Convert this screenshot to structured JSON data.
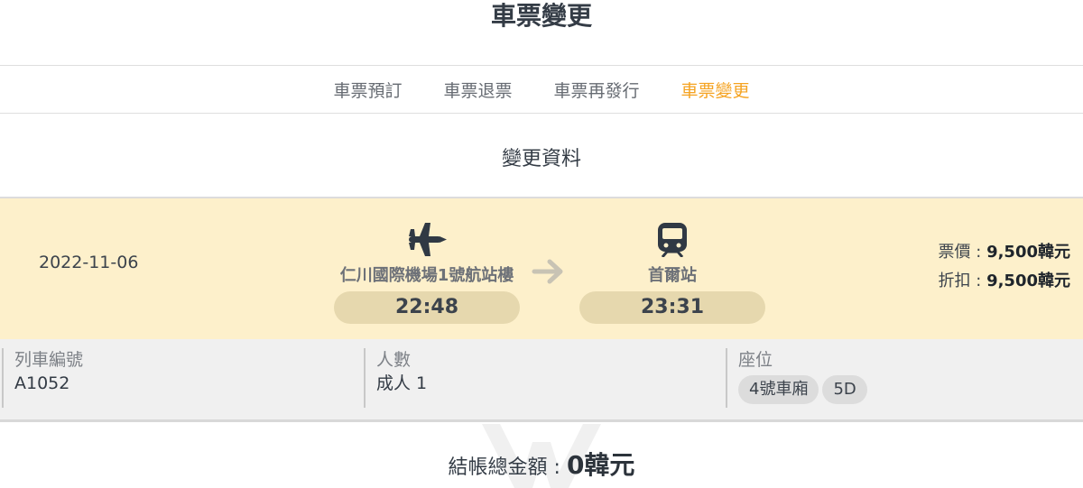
{
  "header": {
    "title": "車票變更"
  },
  "tabs": [
    {
      "label": "車票預訂",
      "active": false
    },
    {
      "label": "車票退票",
      "active": false
    },
    {
      "label": "車票再發行",
      "active": false
    },
    {
      "label": "車票變更",
      "active": true
    }
  ],
  "section": {
    "title": "變更資料"
  },
  "journey": {
    "date": "2022-11-06",
    "departure": {
      "icon": "airplane-icon",
      "station": "仁川國際機場1號航站樓",
      "time": "22:48"
    },
    "arrival": {
      "icon": "train-icon",
      "station": "首爾站",
      "time": "23:31"
    },
    "fare_label": "票價 : ",
    "fare_value": "9,500韓元",
    "discount_label": "折扣 : ",
    "discount_value": "9,500韓元"
  },
  "details": {
    "train_no_label": "列車編號",
    "train_no": "A1052",
    "passengers_label": "人數",
    "passengers": "成人 1",
    "seat_label": "座位",
    "car": "4號車廂",
    "seat": "5D"
  },
  "total": {
    "label": "結帳總金額 : ",
    "amount": "0韓元"
  },
  "colors": {
    "accent": "#f5a321",
    "journey_bg": "#fdf0cb",
    "pill": "#e6d8ae",
    "details_bg": "#f0f0f0"
  }
}
